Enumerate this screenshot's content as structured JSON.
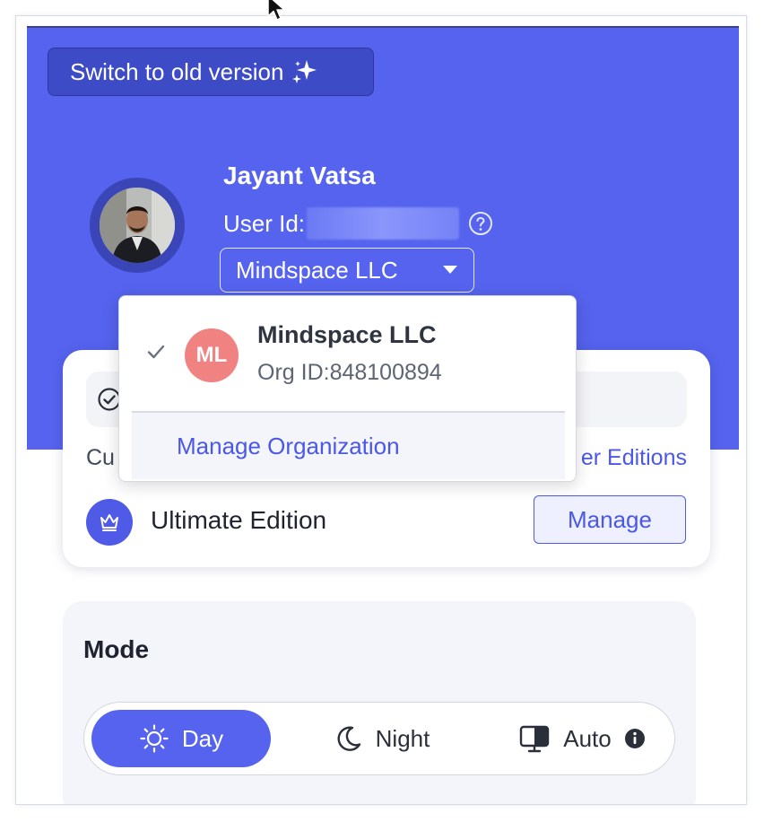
{
  "header": {
    "switch_label": "Switch to old version",
    "user_name": "Jayant Vatsa",
    "user_id_label": "User Id:",
    "org_selected": "Mindspace LLC"
  },
  "org_dropdown": {
    "items": [
      {
        "initials": "ML",
        "name": "Mindspace LLC",
        "org_id": "Org ID:848100894",
        "selected": true
      }
    ],
    "manage_label": "Manage Organization"
  },
  "edition_card": {
    "left_text_fragment": "Cu",
    "right_link_fragment": "er Editions",
    "edition_name": "Ultimate Edition",
    "manage_label": "Manage"
  },
  "mode": {
    "title": "Mode",
    "options": [
      {
        "label": "Day",
        "icon": "sun-icon",
        "active": true
      },
      {
        "label": "Night",
        "icon": "moon-icon",
        "active": false
      },
      {
        "label": "Auto",
        "icon": "monitor-icon",
        "active": false
      }
    ]
  },
  "colors": {
    "header_bg": "#5563ee",
    "accent": "#4b58e6",
    "avatar_bg": "#f08282"
  }
}
